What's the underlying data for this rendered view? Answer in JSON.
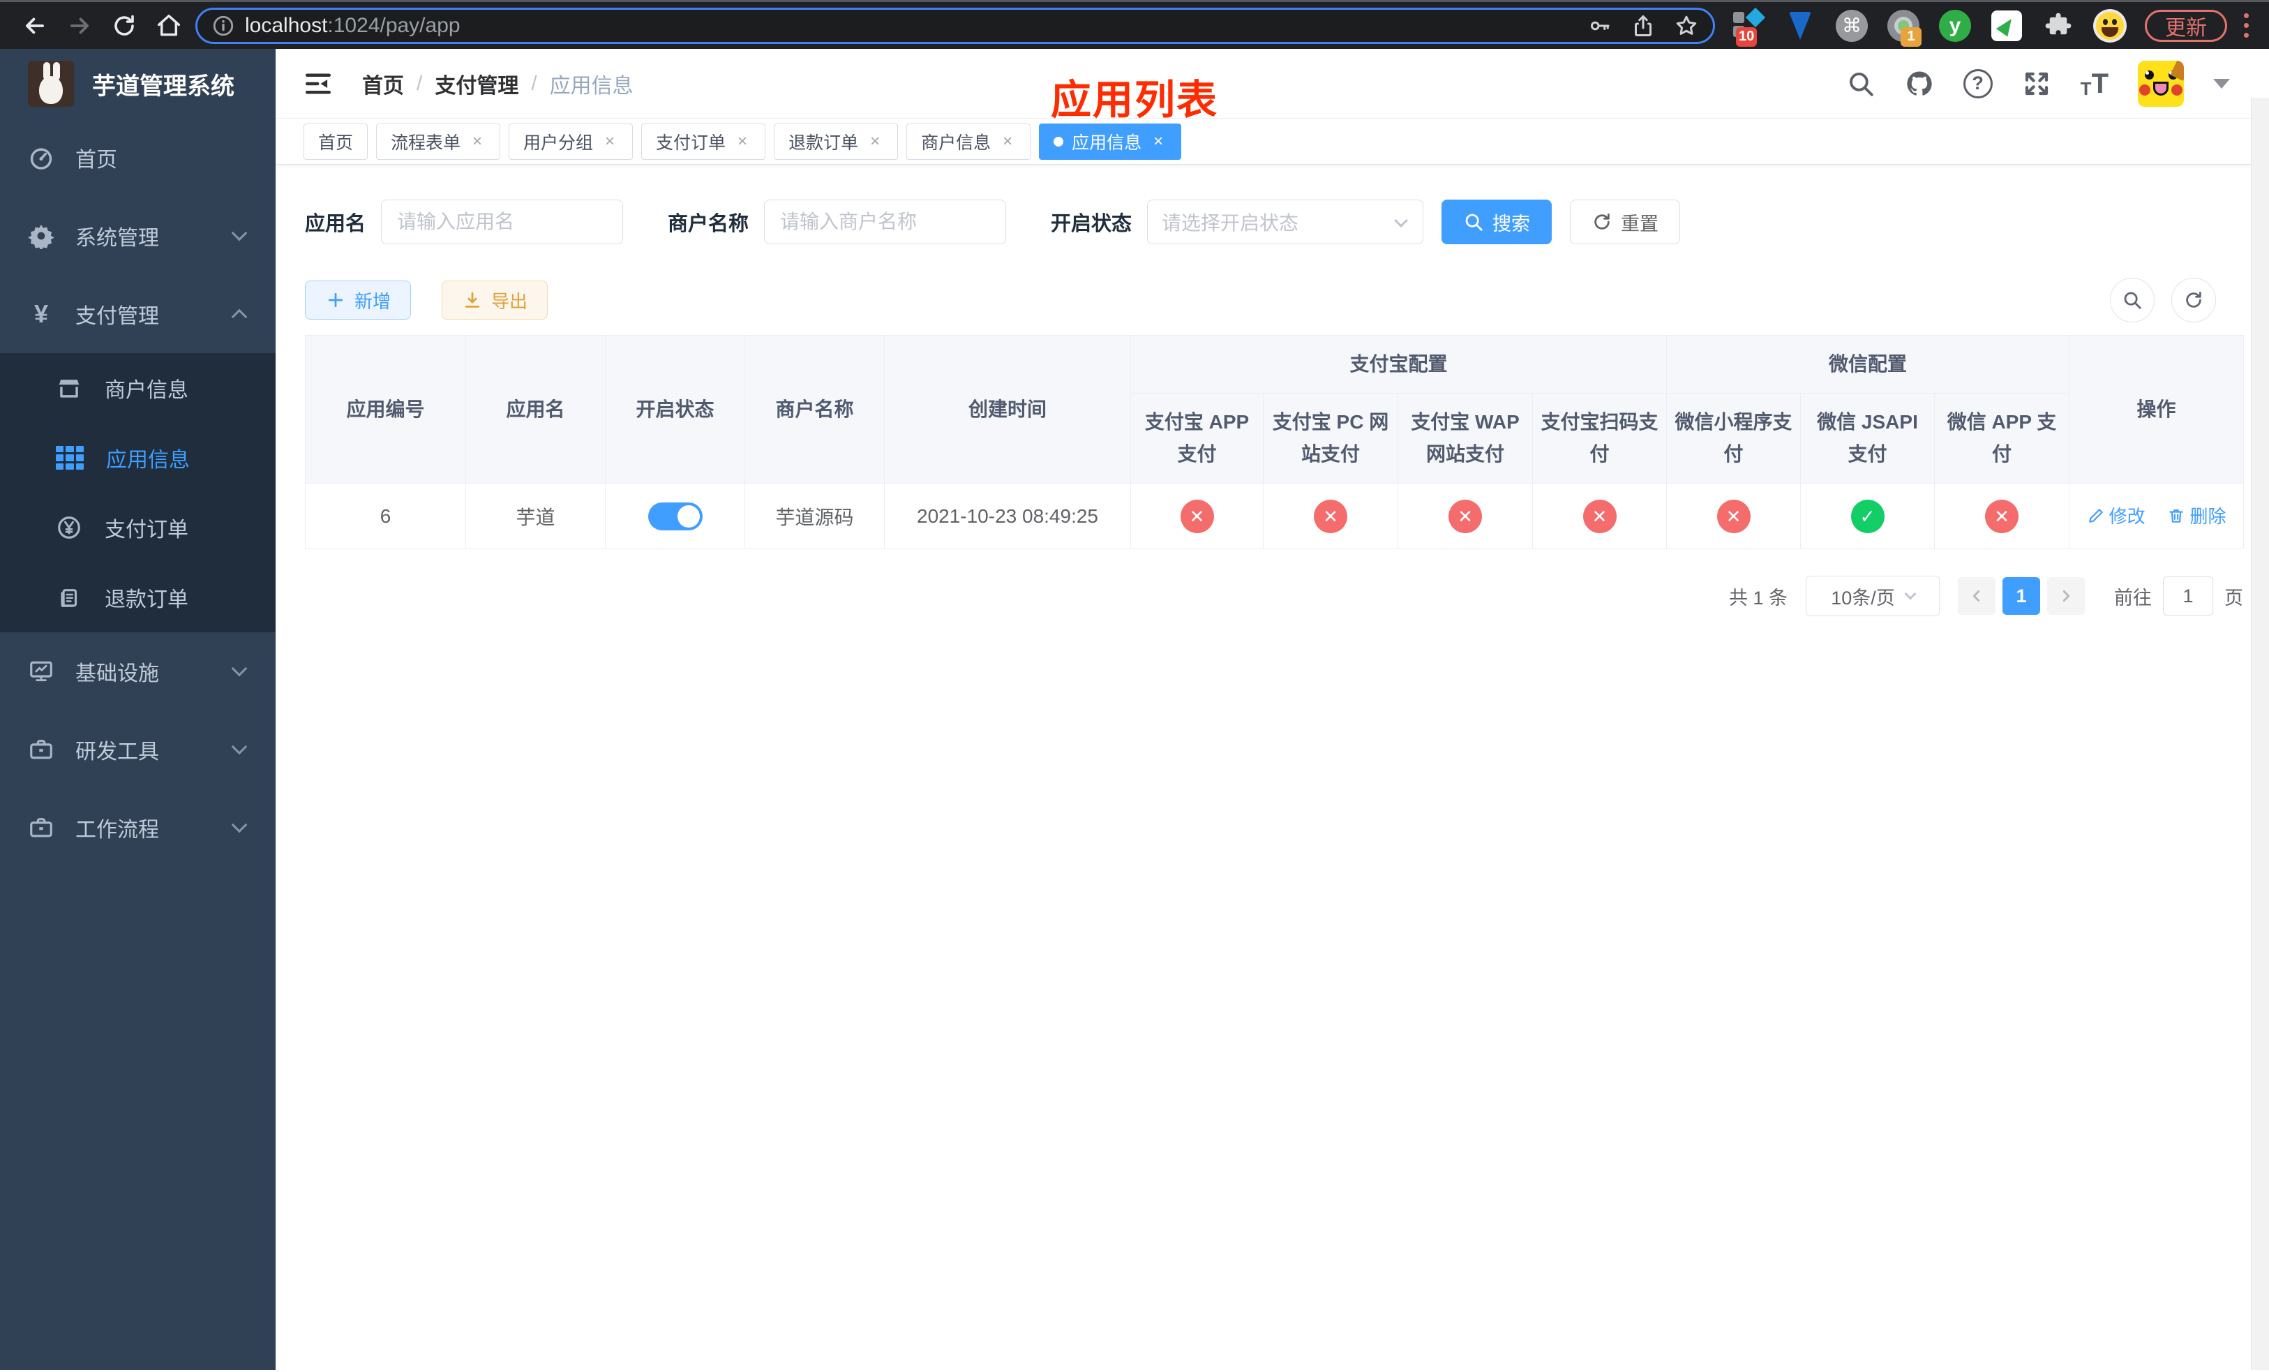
{
  "theme": {
    "accent": "#409eff",
    "success": "#13ce66",
    "danger": "#f56c6c",
    "warning": "#e6a23c",
    "annotation_red": "#fe2c00",
    "sidebar_bg": "#304156",
    "submenu_bg": "#1f2d3d"
  },
  "browser": {
    "url_host": "localhost",
    "url_rest": ":1024/pay/app",
    "update_label": "更新",
    "extension_badge_count": "10",
    "extension_badge_count2": "1",
    "extension_letter": "y"
  },
  "sidebar": {
    "title": "芋道管理系统",
    "items": [
      {
        "label": "首页"
      },
      {
        "label": "系统管理"
      },
      {
        "label": "支付管理",
        "expanded": true
      },
      {
        "label": "商户信息"
      },
      {
        "label": "应用信息",
        "active": true
      },
      {
        "label": "支付订单"
      },
      {
        "label": "退款订单"
      },
      {
        "label": "基础设施"
      },
      {
        "label": "研发工具"
      },
      {
        "label": "工作流程"
      }
    ]
  },
  "header": {
    "breadcrumb": [
      "首页",
      "支付管理",
      "应用信息"
    ],
    "separator": "/",
    "annotation": "应用列表"
  },
  "tabs": [
    {
      "label": "首页",
      "closable": false,
      "active": false
    },
    {
      "label": "流程表单",
      "closable": true,
      "active": false
    },
    {
      "label": "用户分组",
      "closable": true,
      "active": false
    },
    {
      "label": "支付订单",
      "closable": true,
      "active": false
    },
    {
      "label": "退款订单",
      "closable": true,
      "active": false
    },
    {
      "label": "商户信息",
      "closable": true,
      "active": false
    },
    {
      "label": "应用信息",
      "closable": true,
      "active": true
    }
  ],
  "filters": {
    "app_name_label": "应用名",
    "app_name_placeholder": "请输入应用名",
    "merchant_label": "商户名称",
    "merchant_placeholder": "请输入商户名称",
    "status_label": "开启状态",
    "status_placeholder": "请选择开启状态",
    "search_label": "搜索",
    "reset_label": "重置"
  },
  "toolbar": {
    "add_label": "新增",
    "export_label": "导出"
  },
  "table": {
    "groups": {
      "alipay": "支付宝配置",
      "wechat": "微信配置"
    },
    "columns": {
      "app_id": "应用编号",
      "app_name": "应用名",
      "status": "开启状态",
      "merchant": "商户名称",
      "created": "创建时间",
      "alipay_app": "支付宝 APP 支付",
      "alipay_pc": "支付宝 PC 网站支付",
      "alipay_wap": "支付宝 WAP 网站支付",
      "alipay_scan": "支付宝扫码支付",
      "wechat_lite": "微信小程序支付",
      "wechat_jsapi": "微信 JSAPI 支付",
      "wechat_app": "微信 APP 支付",
      "actions": "操作"
    },
    "rows": [
      {
        "app_id": "6",
        "app_name": "芋道",
        "status": "on",
        "merchant": "芋道源码",
        "created": "2021-10-23 08:49:25",
        "payments": {
          "alipay_app": "off",
          "alipay_pc": "off",
          "alipay_wap": "off",
          "alipay_scan": "off",
          "wechat_lite": "off",
          "wechat_jsapi": "on",
          "wechat_app": "off"
        },
        "actions": {
          "edit": "修改",
          "delete": "删除"
        }
      }
    ]
  },
  "pagination": {
    "total": "共 1 条",
    "page_size": "10条/页",
    "current_page": "1",
    "goto_label": "前往",
    "goto_value": "1",
    "page_unit": "页"
  }
}
